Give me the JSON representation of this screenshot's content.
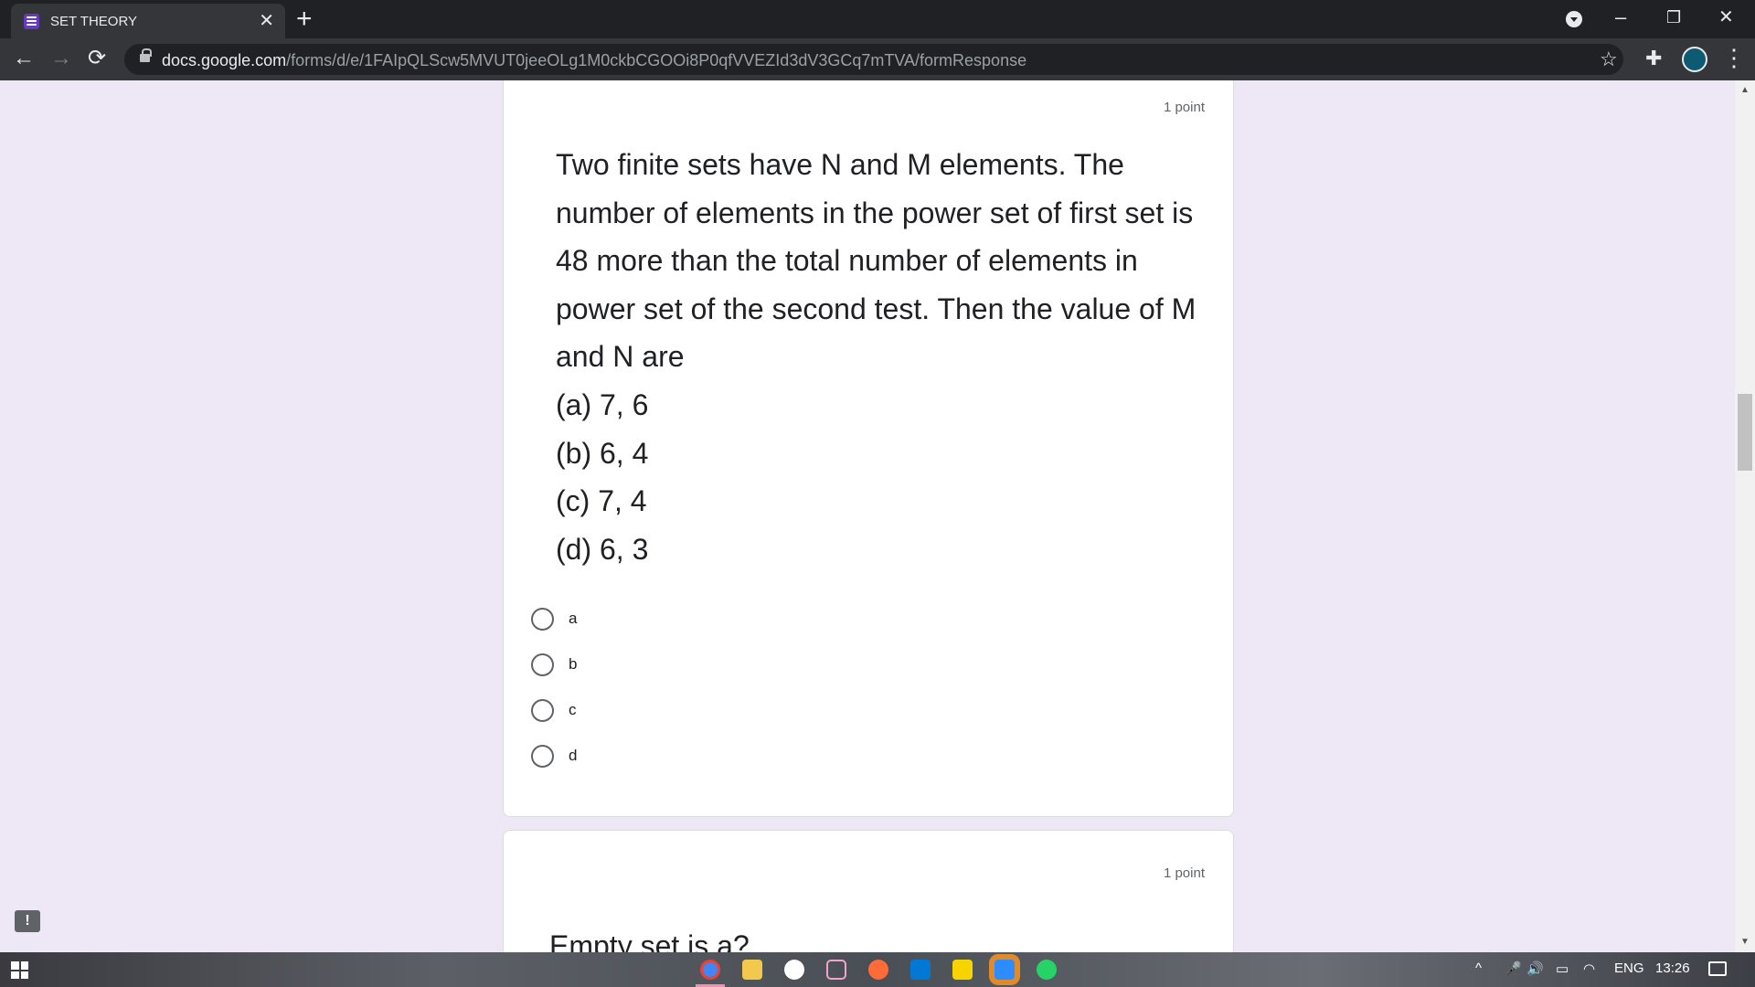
{
  "browser": {
    "tab_title": "SET THEORY",
    "tab_close": "✕",
    "new_tab": "+",
    "url_host": "docs.google.com",
    "url_path": "/forms/d/e/1FAIpQLScw5MVUT0jeeOLg1M0ckbCGOOi8P0qfVVEZId3dV3GCq7mTVA/formResponse",
    "back_glyph": "←",
    "forward_glyph": "→",
    "reload_glyph": "⟳",
    "star_glyph": "☆",
    "extensions_glyph": "✚",
    "menu_glyph": "⋮",
    "minimize_glyph": "–",
    "restore_glyph": "❐",
    "close_glyph": "✕"
  },
  "question1": {
    "points": "1 point",
    "text": "Two finite sets have N and M elements. The number of elements in the power set of first set is 48 more than the total number of elements in power set of the second test. Then the value of M and N are",
    "option_lines": [
      "(a) 7, 6",
      "(b) 6, 4",
      "(c) 7, 4",
      "(d) 6, 3"
    ],
    "choices": [
      "a",
      "b",
      "c",
      "d"
    ]
  },
  "question2": {
    "points": "1 point",
    "text": "Empty set is a?"
  },
  "feedback_glyph": "!",
  "taskbar": {
    "apps": [
      "chrome-icon",
      "file-explorer-icon",
      "app-icon",
      "terminal-icon",
      "postman-icon",
      "vscode-icon",
      "sticky-notes-icon",
      "zoom-icon",
      "whatsapp-icon"
    ],
    "tray_chevron": "^",
    "language": "ENG",
    "time": "13:26"
  },
  "colors": {
    "accent": "#673ab7",
    "page_bg": "#ede7f6",
    "chrome_dark": "#202124",
    "chrome_toolbar": "#35363a"
  }
}
